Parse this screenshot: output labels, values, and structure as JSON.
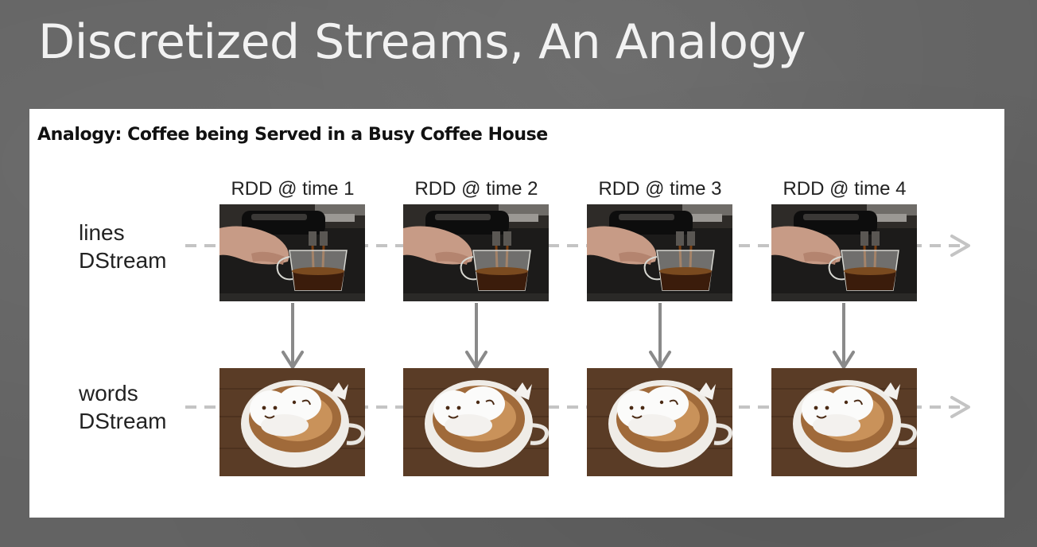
{
  "title": "Discretized Streams, An Analogy",
  "analogy_heading": "Analogy: Coffee being Served in a Busy Coffee House",
  "rows": {
    "lines": {
      "line1": "lines",
      "line2": "DStream"
    },
    "words": {
      "line1": "words",
      "line2": "DStream"
    }
  },
  "columns": [
    {
      "label": "RDD @ time 1"
    },
    {
      "label": "RDD @ time 2"
    },
    {
      "label": "RDD @ time 3"
    },
    {
      "label": "RDD @ time 4"
    }
  ],
  "images": {
    "top": "espresso-being-poured-photo",
    "bottom": "latte-art-cup-photo"
  },
  "colors": {
    "background": "#636363",
    "panel": "#ffffff",
    "dashed_arrow": "#c4c4c4",
    "down_arrow": "#8a8a8a"
  }
}
